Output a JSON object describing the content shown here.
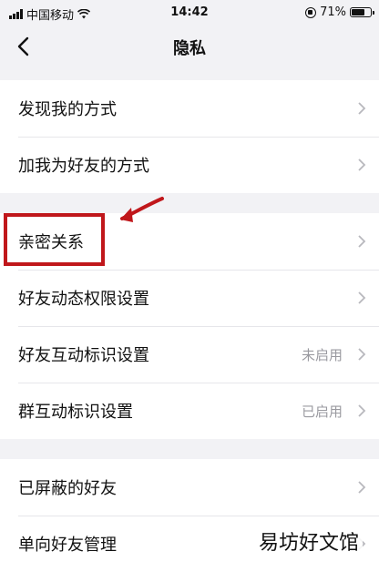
{
  "status": {
    "carrier": "中国移动",
    "time": "14:42",
    "battery": "71%"
  },
  "nav": {
    "title": "隐私"
  },
  "groups": [
    {
      "items": [
        {
          "label": "发现我的方式",
          "value": ""
        },
        {
          "label": "加我为好友的方式",
          "value": ""
        }
      ]
    },
    {
      "items": [
        {
          "label": "亲密关系",
          "value": ""
        },
        {
          "label": "好友动态权限设置",
          "value": ""
        },
        {
          "label": "好友互动标识设置",
          "value": "未启用"
        },
        {
          "label": "群互动标识设置",
          "value": "已启用"
        }
      ]
    },
    {
      "items": [
        {
          "label": "已屏蔽的好友",
          "value": ""
        },
        {
          "label": "单向好友管理",
          "value": ""
        }
      ]
    }
  ],
  "watermark": "易坊好文馆",
  "colors": {
    "background": "#f2f2f5",
    "highlight": "#c0171b",
    "secondary_text": "#9a9aa0"
  }
}
